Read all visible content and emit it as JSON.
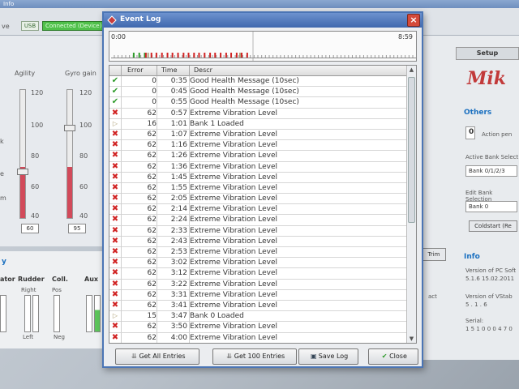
{
  "main_window": {
    "title": "Info",
    "toolbar": {
      "left_text": "ve",
      "usb": "USB",
      "connection": "Connected (Device)"
    },
    "left_panel": {
      "sliders": [
        {
          "label": "Agility",
          "ticks": [
            "120",
            "100",
            "80",
            "60",
            "40"
          ],
          "value": "60"
        },
        {
          "label": "Gyro gain",
          "ticks": [
            "120",
            "100",
            "80",
            "60",
            "40"
          ],
          "value": "95"
        }
      ],
      "side_labels": [
        "k",
        "e",
        "m"
      ]
    },
    "bottom_left": {
      "title": "y",
      "columns": [
        {
          "label": "ator"
        },
        {
          "label": "Rudder",
          "top": "Right",
          "bottom": "Left"
        },
        {
          "label": "Coll.",
          "top": "Pos",
          "bottom": "Neg"
        },
        {
          "label": "Aux"
        }
      ]
    },
    "right_panel": {
      "setup_tab": "Setup",
      "logo": "Mik",
      "others_title": "Others",
      "action_value": "0",
      "action_label": "Action pen",
      "active_bank_label": "Active Bank Select",
      "active_bank_value": "Bank 0/1/2/3",
      "edit_bank_label": "Edit Bank Selection",
      "edit_bank_value": "Bank 0",
      "coldstart_button": "Coldstart (Re",
      "trim_button": "Trim",
      "act_label": "act",
      "info_title": "Info",
      "version_pc_label": "Version of PC Soft",
      "version_pc_value": "5.1.6   15.02.2011",
      "version_vstab_label": "Version of VStab",
      "version_vstab_value": "5 . 1 . 6",
      "serial_label": "Serial:",
      "serial_value": "1 5 1 0 0 0 4 7 0"
    }
  },
  "dialog": {
    "title": "Event Log",
    "close_glyph": "×",
    "timeline": {
      "start": "0:00",
      "end": "8:59"
    },
    "columns": {
      "error": "Error",
      "time": "Time",
      "descr": "Descr"
    },
    "entries": [
      {
        "icon": "check",
        "error": "0",
        "time": "0:35",
        "descr": "Good Health Message (10sec)"
      },
      {
        "icon": "check",
        "error": "0",
        "time": "0:45",
        "descr": "Good Health Message (10sec)"
      },
      {
        "icon": "check",
        "error": "0",
        "time": "0:55",
        "descr": "Good Health Message (10sec)"
      },
      {
        "icon": "cross",
        "error": "62",
        "time": "0:57",
        "descr": "Extreme Vibration Level"
      },
      {
        "icon": "info",
        "error": "16",
        "time": "1:01",
        "descr": "Bank 1 Loaded"
      },
      {
        "icon": "cross",
        "error": "62",
        "time": "1:07",
        "descr": "Extreme Vibration Level"
      },
      {
        "icon": "cross",
        "error": "62",
        "time": "1:16",
        "descr": "Extreme Vibration Level"
      },
      {
        "icon": "cross",
        "error": "62",
        "time": "1:26",
        "descr": "Extreme Vibration Level"
      },
      {
        "icon": "cross",
        "error": "62",
        "time": "1:36",
        "descr": "Extreme Vibration Level"
      },
      {
        "icon": "cross",
        "error": "62",
        "time": "1:45",
        "descr": "Extreme Vibration Level"
      },
      {
        "icon": "cross",
        "error": "62",
        "time": "1:55",
        "descr": "Extreme Vibration Level"
      },
      {
        "icon": "cross",
        "error": "62",
        "time": "2:05",
        "descr": "Extreme Vibration Level"
      },
      {
        "icon": "cross",
        "error": "62",
        "time": "2:14",
        "descr": "Extreme Vibration Level"
      },
      {
        "icon": "cross",
        "error": "62",
        "time": "2:24",
        "descr": "Extreme Vibration Level"
      },
      {
        "icon": "cross",
        "error": "62",
        "time": "2:33",
        "descr": "Extreme Vibration Level"
      },
      {
        "icon": "cross",
        "error": "62",
        "time": "2:43",
        "descr": "Extreme Vibration Level"
      },
      {
        "icon": "cross",
        "error": "62",
        "time": "2:53",
        "descr": "Extreme Vibration Level"
      },
      {
        "icon": "cross",
        "error": "62",
        "time": "3:02",
        "descr": "Extreme Vibration Level"
      },
      {
        "icon": "cross",
        "error": "62",
        "time": "3:12",
        "descr": "Extreme Vibration Level"
      },
      {
        "icon": "cross",
        "error": "62",
        "time": "3:22",
        "descr": "Extreme Vibration Level"
      },
      {
        "icon": "cross",
        "error": "62",
        "time": "3:31",
        "descr": "Extreme Vibration Level"
      },
      {
        "icon": "cross",
        "error": "62",
        "time": "3:41",
        "descr": "Extreme Vibration Level"
      },
      {
        "icon": "info",
        "error": "15",
        "time": "3:47",
        "descr": "Bank 0 Loaded"
      },
      {
        "icon": "cross",
        "error": "62",
        "time": "3:50",
        "descr": "Extreme Vibration Level"
      },
      {
        "icon": "cross",
        "error": "62",
        "time": "4:00",
        "descr": "Extreme Vibration Level"
      }
    ],
    "buttons": {
      "get_all": "Get All Entries",
      "get_100": "Get 100 Entries",
      "save": "Save Log",
      "close": "Close"
    }
  },
  "colors": {
    "title_bar": "#3f68ad",
    "check": "#2e9b2a",
    "cross": "#d12424",
    "close_button": "#d44a3a"
  }
}
